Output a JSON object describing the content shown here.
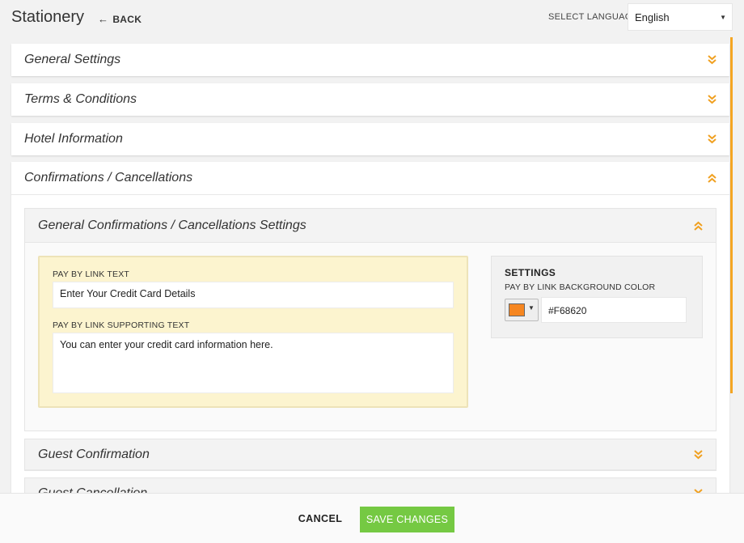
{
  "header": {
    "title": "Stationery",
    "back_label": "BACK",
    "language_label": "SELECT LANGUAGE",
    "language_value": "English"
  },
  "sections": {
    "general_settings": "General Settings",
    "terms": "Terms & Conditions",
    "hotel_info": "Hotel Information",
    "confirmations": "Confirmations / Cancellations"
  },
  "confirmations": {
    "sub_title": "General Confirmations / Cancellations Settings",
    "pay_by_link_label": "PAY BY LINK TEXT",
    "pay_by_link_value": "Enter Your Credit Card Details",
    "supporting_label": "PAY BY LINK SUPPORTING TEXT",
    "supporting_value": "You can enter your credit card information here.",
    "settings_heading": "SETTINGS",
    "bg_color_label": "PAY BY LINK BACKGROUND COLOR",
    "bg_color_value": "#F68620",
    "guest_confirmation": "Guest Confirmation",
    "guest_cancellation": "Guest Cancellation"
  },
  "footer": {
    "cancel_label": "CANCEL",
    "save_label": "SAVE CHANGES"
  },
  "colors": {
    "accent": "#f0a020",
    "save_button": "#75c943",
    "swatch": "#F68620",
    "highlight_box": "#fcf4cf"
  },
  "icons": {
    "back": "arrow-left-icon",
    "collapsed": "double-chevron-down-icon",
    "expanded": "double-chevron-up-icon",
    "dropdown": "caret-down-icon"
  }
}
